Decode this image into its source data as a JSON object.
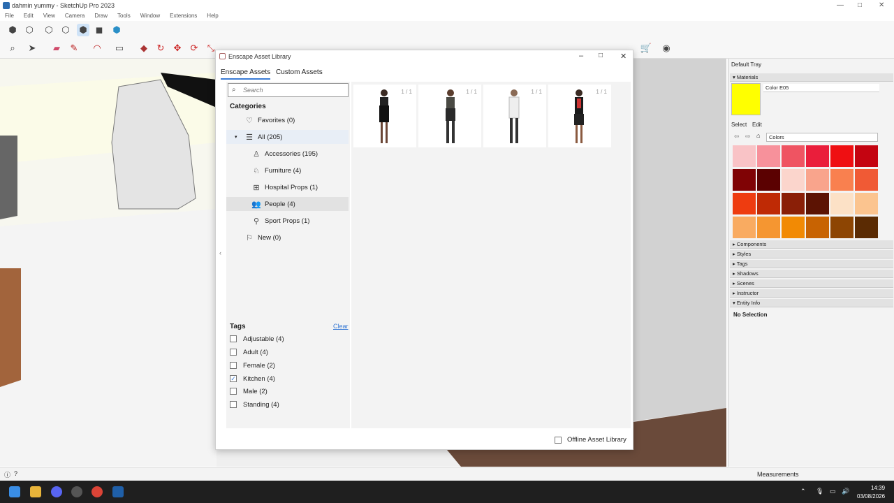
{
  "window": {
    "title": "dahmin yummy - SketchUp Pro 2023",
    "controls": [
      "—",
      "□",
      "✕"
    ]
  },
  "menu": [
    "File",
    "Edit",
    "View",
    "Camera",
    "Draw",
    "Tools",
    "Window",
    "Extensions",
    "Help"
  ],
  "dialog": {
    "title": "Enscape Asset Library",
    "tabs": [
      "Enscape Assets",
      "Custom Assets"
    ],
    "search_placeholder": "Search",
    "categories_heading": "Categories",
    "categories": [
      {
        "label": "Favorites (0)",
        "icon": "heart-icon",
        "indent": 0
      },
      {
        "label": "All (205)",
        "icon": "list-icon",
        "indent": 0,
        "expanded": true
      },
      {
        "label": "Accessories (195)",
        "icon": "lamp-icon",
        "indent": 1
      },
      {
        "label": "Furniture (4)",
        "icon": "chair-icon",
        "indent": 1
      },
      {
        "label": "Hospital Props (1)",
        "icon": "medkit-icon",
        "indent": 1
      },
      {
        "label": "People (4)",
        "icon": "people-icon",
        "indent": 1,
        "selected": true
      },
      {
        "label": "Sport Props (1)",
        "icon": "racket-icon",
        "indent": 1
      },
      {
        "label": "New (0)",
        "icon": "flag-icon",
        "indent": 0
      }
    ],
    "tags_heading": "Tags",
    "clear_label": "Clear",
    "tags": [
      {
        "label": "Adjustable (4)",
        "checked": false
      },
      {
        "label": "Adult (4)",
        "checked": false
      },
      {
        "label": "Female (2)",
        "checked": false
      },
      {
        "label": "Kitchen (4)",
        "checked": true
      },
      {
        "label": "Male (2)",
        "checked": false
      },
      {
        "label": "Standing (4)",
        "checked": false
      }
    ],
    "assets": [
      {
        "count": "1 / 1"
      },
      {
        "count": "1 / 1"
      },
      {
        "count": "1 / 1"
      },
      {
        "count": "1 / 1"
      }
    ],
    "offline_label": "Offline Asset Library"
  },
  "tray": {
    "title": "Default Tray",
    "materials_label": "Materials",
    "material_name": "Color E05",
    "material_color": "#ffff00",
    "select_label": "Select",
    "edit_label": "Edit",
    "collection": "Colors",
    "swatches": [
      "#f9c3c6",
      "#f7919b",
      "#ef5462",
      "#ea1e3b",
      "#ef0f12",
      "#c40411",
      "#800305",
      "#5b0101",
      "#fbd5cc",
      "#f9a48c",
      "#f9804f",
      "#f05a35",
      "#ee3c10",
      "#bf2a05",
      "#8a1f07",
      "#5c1303",
      "#fce1c6",
      "#fbc48f",
      "#f9ab61",
      "#f59631",
      "#f28a04",
      "#c86302",
      "#8d4503",
      "#5b2b03"
    ],
    "sections": [
      "Components",
      "Styles",
      "Tags",
      "Shadows",
      "Scenes",
      "Instructor",
      "Entity Info"
    ],
    "entity_info": "No Selection"
  },
  "status": {
    "measurements": "Measurements"
  },
  "taskbar": {
    "time": "14:39",
    "date": "03/08/2026"
  }
}
